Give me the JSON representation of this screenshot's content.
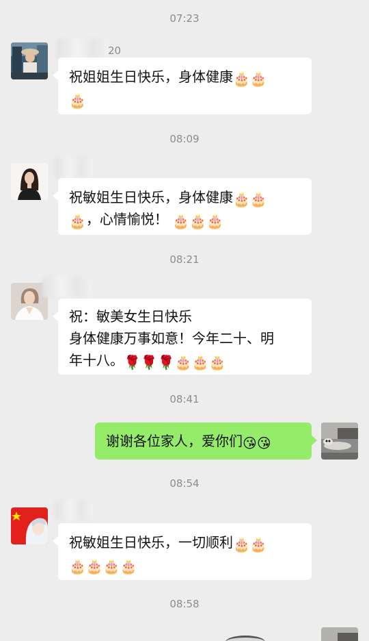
{
  "messages": [
    {
      "time": "07:23",
      "name_suffix": "20",
      "lines": [
        [
          "祝姐姐生日快乐，身体健康",
          "🎂",
          "🎂"
        ],
        [
          "🎂"
        ]
      ]
    },
    {
      "time": "08:09",
      "lines": [
        [
          "祝敏姐生日快乐，身体健康",
          "🎂",
          "🎂"
        ],
        [
          "🎂",
          "，心情愉悦！ ",
          "🎂",
          "🎂",
          "🎂"
        ]
      ]
    },
    {
      "time": "08:21",
      "lines": [
        [
          "祝：敏美女生日快乐"
        ],
        [
          "身体健康万事如意！今年二十、明"
        ],
        [
          "年十八。",
          "🌹",
          "🌹",
          "🌹",
          "🎂",
          "🎂",
          "🎂"
        ]
      ]
    },
    {
      "time": "08:41",
      "self": true,
      "lines": [
        [
          "谢谢各位家人，爱你们",
          "😘",
          "😘"
        ]
      ]
    },
    {
      "time": "08:54",
      "lines": [
        [
          "祝敏姐生日快乐，一切顺利",
          "🎂",
          "🎂"
        ],
        [
          "🎂",
          "🎂",
          "🎂",
          "🎂"
        ]
      ]
    },
    {
      "time": "08:58"
    }
  ],
  "colors": {
    "background": "#ededed",
    "self_bubble": "#95ec69",
    "other_bubble": "#ffffff",
    "time_text": "#8c8c8c"
  }
}
